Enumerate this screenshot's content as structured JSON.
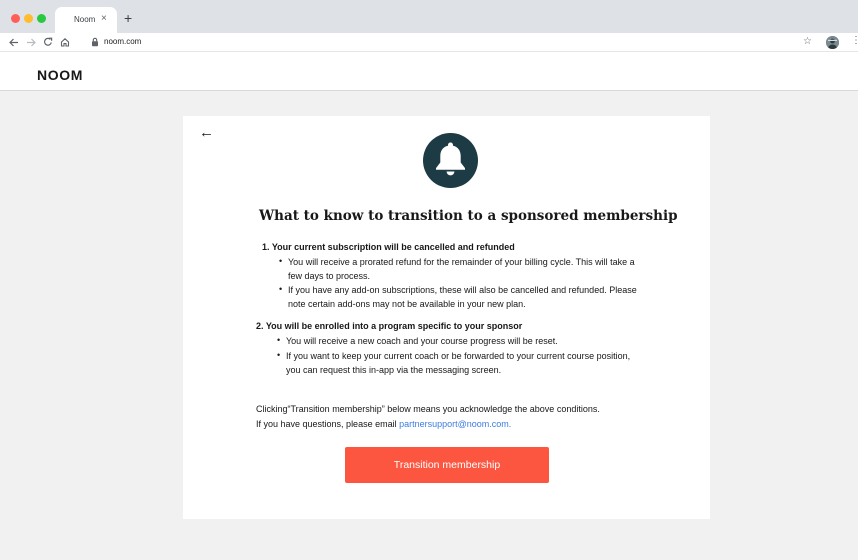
{
  "browser": {
    "tab_title": "Noom",
    "tab_close": "×",
    "new_tab": "+",
    "url": "noom.com",
    "icons": [
      "back-icon",
      "forward-icon",
      "reload-icon",
      "home-icon",
      "lock-icon",
      "star-icon",
      "profile-avatar",
      "more-icon"
    ]
  },
  "header": {
    "logo": "NOOM"
  },
  "card": {
    "back_arrow": "←",
    "title": "What to know to transition to a sponsored membership",
    "sections": [
      {
        "heading": "1. Your current subscription will be cancelled and refunded",
        "bullets": [
          "You will receive a prorated refund for the remainder of your billing cycle. This will take a few days to process.",
          "If you have any add-on subscriptions, these will also be cancelled and refunded. Please note certain add-ons may not be available in your new plan."
        ]
      },
      {
        "heading": "2. You will be enrolled into a program specific to your sponsor",
        "bullets": [
          "You will receive a new coach and your course progress will be reset.",
          "If you want to keep your current coach or be forwarded to your current course position, you can request this in-app via the messaging screen."
        ]
      }
    ],
    "ack_line1": "Clicking“Transition membership” below means you acknowledge the above conditions.",
    "ack_line2_prefix": "If you have questions, please email ",
    "email": "partnersupport@noom.com.",
    "button_label": "Transition membership"
  },
  "colors": {
    "accent": "#fc5640",
    "bell_bg": "#1c3b45",
    "link": "#3d7de0",
    "page_bg": "#f1f1f1"
  }
}
